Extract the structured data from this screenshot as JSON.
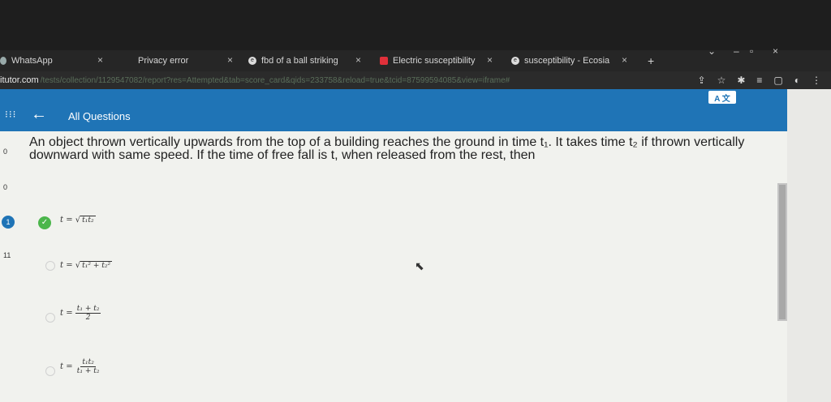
{
  "tabs": [
    {
      "label": "WhatsApp",
      "close": "×"
    },
    {
      "label": "Privacy error",
      "close": "×"
    },
    {
      "label": "fbd of a ball striking",
      "close": "×"
    },
    {
      "label": "Electric susceptibility",
      "close": "×"
    },
    {
      "label": "susceptibility - Ecosia",
      "close": "×"
    }
  ],
  "new_tab": "+",
  "address": {
    "domain": "itutor.com",
    "path": "/tests/collection/1129547082/report?res=Attempted&tab=score_card&qids=233758&reload=true&tcid=87599594085&view=iframe#"
  },
  "header": {
    "title": "All Questions",
    "lang_badge": "A 文"
  },
  "sidebar": {
    "num_a": "0",
    "num_b": "0",
    "badge": "1",
    "num_c": "11"
  },
  "question": {
    "text": "An object thrown vertically upwards from the top of a building reaches the ground in time t₁. It takes time t₂ if thrown vertically downward with same speed. If the time of free fall is t, when released from the rest, then"
  },
  "options": [
    {
      "lhs": "t =",
      "expr": "t₁t₂",
      "kind": "sqrt"
    },
    {
      "lhs": "t =",
      "expr": "t₁² + t₂²",
      "kind": "sqrt"
    },
    {
      "lhs": "t =",
      "num": "t₁ + t₂",
      "den": "2",
      "kind": "frac"
    },
    {
      "lhs": "t =",
      "num": "t₁t₂",
      "den": "t₁ + t₂",
      "kind": "frac"
    }
  ],
  "colors": {
    "header_blue": "#1f74b6",
    "check_green": "#4bb64b",
    "page_bg": "#f1f2ee"
  }
}
